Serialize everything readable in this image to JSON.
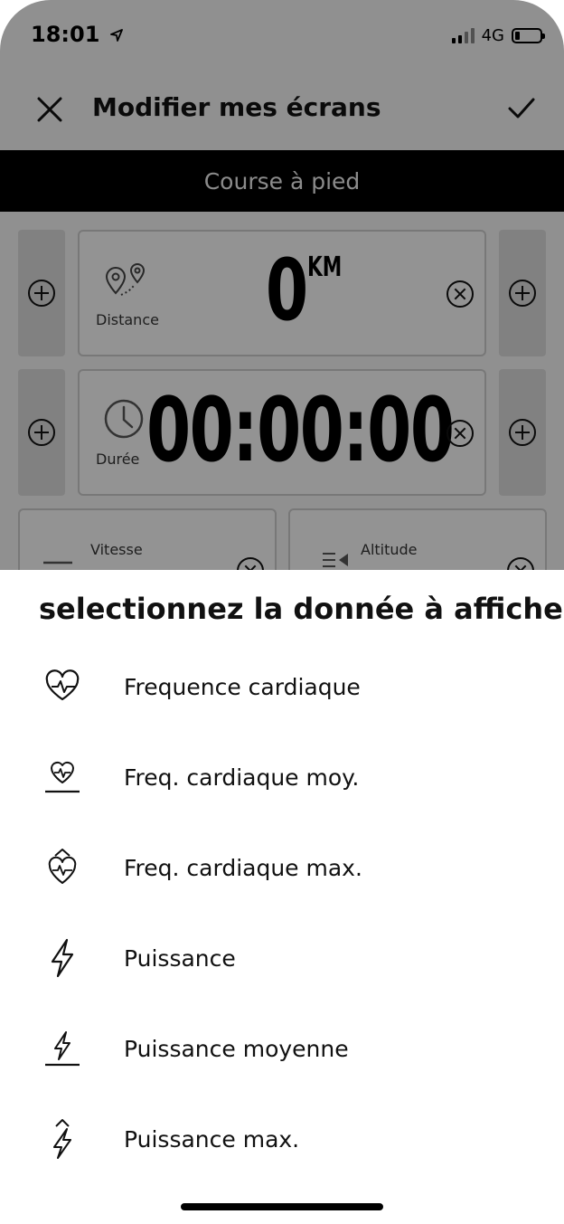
{
  "status_bar": {
    "time": "18:01",
    "network": "4G"
  },
  "header": {
    "title": "Modifier mes écrans",
    "close_icon": "close-icon",
    "confirm_icon": "checkmark-icon"
  },
  "sport": {
    "label": "Course à pied"
  },
  "tiles": [
    {
      "label": "Distance",
      "value": "0",
      "unit": "KM",
      "icon": "map-pin-route-icon"
    },
    {
      "label": "Durée",
      "value": "00:00:00",
      "unit": "",
      "icon": "clock-icon"
    },
    {
      "label": "Vitesse",
      "value": "",
      "unit": "",
      "icon": "speed-icon"
    },
    {
      "label": "Altitude",
      "value": "",
      "unit": "",
      "icon": "altitude-icon"
    }
  ],
  "sheet": {
    "title": "selectionnez la donnée à afficher",
    "options": [
      {
        "label": "Frequence cardiaque",
        "icon": "heart-rate-icon"
      },
      {
        "label": "Freq. cardiaque moy.",
        "icon": "heart-rate-average-icon"
      },
      {
        "label": "Freq. cardiaque max.",
        "icon": "heart-rate-max-icon"
      },
      {
        "label": "Puissance",
        "icon": "power-bolt-icon"
      },
      {
        "label": "Puissance moyenne",
        "icon": "power-average-icon"
      },
      {
        "label": "Puissance max.",
        "icon": "power-max-icon"
      }
    ]
  },
  "colors": {
    "sport_bar": "#000000",
    "overlay": "#000000",
    "sheet_bg": "#ffffff"
  }
}
